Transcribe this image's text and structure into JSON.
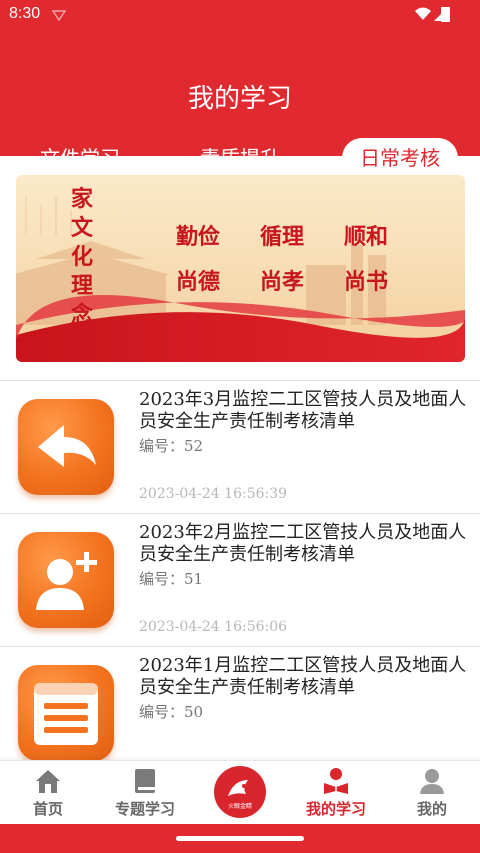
{
  "status_bar": {
    "time": "8:30"
  },
  "header": {
    "title": "我的学习",
    "tabs": [
      {
        "label": "文件学习",
        "active": false
      },
      {
        "label": "素质提升",
        "active": false
      },
      {
        "label": "日常考核",
        "active": true
      }
    ]
  },
  "banner": {
    "vertical_text": [
      "家",
      "文",
      "化",
      "理",
      "念"
    ],
    "words": [
      "勤俭",
      "循理",
      "顺和",
      "尚德",
      "尚孝",
      "尚书"
    ]
  },
  "list": {
    "items": [
      {
        "title": "2023年3月监控二工区管技人员及地面人员安全生产责任制考核清单",
        "code": "编号：52",
        "date": "2023-04-24 16:56:39",
        "icon": "reply-arrow-icon"
      },
      {
        "title": "2023年2月监控二工区管技人员及地面人员安全生产责任制考核清单",
        "code": "编号：51",
        "date": "2023-04-24 16:56:06",
        "icon": "add-user-icon"
      },
      {
        "title": "2023年1月监控二工区管技人员及地面人员安全生产责任制考核清单",
        "code": "编号：50",
        "date": "",
        "icon": "document-list-icon"
      }
    ]
  },
  "bottom_nav": {
    "items": [
      {
        "label": "首页",
        "icon": "home-icon",
        "active": false
      },
      {
        "label": "专题学习",
        "icon": "book-icon",
        "active": false
      },
      {
        "label": "",
        "icon": "center-logo-icon",
        "active": false
      },
      {
        "label": "我的学习",
        "icon": "reader-icon",
        "active": true
      },
      {
        "label": "我的",
        "icon": "profile-icon",
        "active": false
      }
    ],
    "center_logo_text": "火眼金睛"
  },
  "colors": {
    "primary": "#e02a2f",
    "accent_orange": "#f3731f",
    "active_nav": "#d9262c"
  }
}
